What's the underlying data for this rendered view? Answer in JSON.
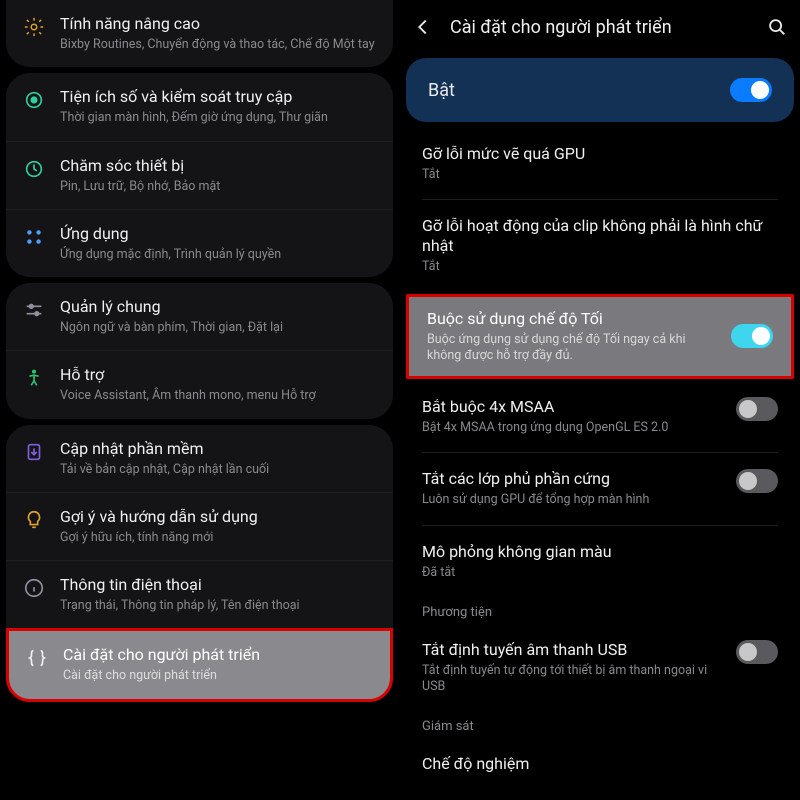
{
  "left": {
    "groups": [
      {
        "rows": [
          {
            "icon": "gear",
            "title": "Tính năng nâng cao",
            "sub": "Bixby Routines, Chuyển động và thao tác, Chế độ Một tay"
          }
        ]
      },
      {
        "rows": [
          {
            "icon": "target",
            "title": "Tiện ích số và kiểm soát truy cập",
            "sub": "Thời gian màn hình, Đếm giờ ứng dụng, Thư giãn"
          },
          {
            "icon": "shield-ring",
            "title": "Chăm sóc thiết bị",
            "sub": "Pin, Lưu trữ, Bộ nhớ, Bảo mật"
          },
          {
            "icon": "grid-dots",
            "title": "Ứng dụng",
            "sub": "Ứng dụng mặc định, Trình quản lý quyền"
          }
        ]
      },
      {
        "rows": [
          {
            "icon": "sliders",
            "title": "Quản lý chung",
            "sub": "Ngôn ngữ và bàn phím, Thời gian, Đặt lại"
          },
          {
            "icon": "accessibility",
            "title": "Hỗ trợ",
            "sub": "Voice Assistant, Âm thanh mono, menu Hỗ trợ"
          }
        ]
      },
      {
        "rows": [
          {
            "icon": "download",
            "title": "Cập nhật phần mềm",
            "sub": "Tải về bản cập nhật, Cập nhật lần cuối"
          },
          {
            "icon": "lightbulb",
            "title": "Gợi ý và hướng dẫn sử dụng",
            "sub": "Gợi ý hữu ích, tính năng mới"
          },
          {
            "icon": "info",
            "title": "Thông tin điện thoại",
            "sub": "Trạng thái, Thông tin pháp lý, Tên điện thoại"
          }
        ]
      }
    ],
    "highlight": {
      "icon": "braces",
      "title": "Cài đặt cho người phát triển",
      "sub": "Cài đặt cho người phát triển"
    }
  },
  "right": {
    "header": "Cài đặt cho người phát triển",
    "banner": "Bật",
    "items": [
      {
        "title": "Gỡ lỗi mức vẽ quá GPU",
        "sub": "Tắt",
        "toggle": null
      },
      {
        "title": "Gỡ lỗi hoạt động của clip không phải là hình chữ nhật",
        "sub": "Tắt",
        "toggle": null
      }
    ],
    "highlight": {
      "title": "Buộc sử dụng chế độ Tối",
      "sub": "Buộc ứng dụng sử dụng chế độ Tối ngay cả khi không được hỗ trợ đầy đủ."
    },
    "items2": [
      {
        "title": "Bắt buộc 4x MSAA",
        "sub": "Bật 4x MSAA trong ứng dụng OpenGL ES 2.0",
        "toggle": false
      },
      {
        "title": "Tắt các lớp phủ phần cứng",
        "sub": "Luôn sử dụng GPU để tổng hợp màn hình",
        "toggle": false
      },
      {
        "title": "Mô phỏng không gian màu",
        "sub": "Đã tắt",
        "toggle": null
      }
    ],
    "section_media": "Phương tiện",
    "items3": [
      {
        "title": "Tắt định tuyến âm thanh USB",
        "sub": "Tắt định tuyến tự động tới thiết bị âm thanh ngoại vi USB",
        "toggle": false
      }
    ],
    "section_monitor": "Giám sát",
    "items4": [
      {
        "title": "Chế độ nghiệm",
        "sub": "",
        "toggle": null
      }
    ]
  }
}
